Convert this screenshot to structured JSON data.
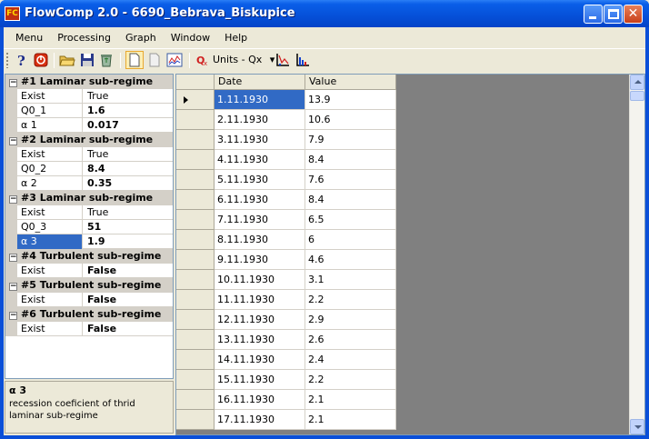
{
  "window": {
    "app_icon_text": "FC",
    "title": "FlowComp 2.0 - 6690_Bebrava_Biskupice",
    "close_glyph": "✕"
  },
  "menu": [
    "Menu",
    "Processing",
    "Graph",
    "Window",
    "Help"
  ],
  "toolbar": {
    "units_label": "Units - Qx",
    "units_dropdown_glyph": "▾",
    "icons": [
      "help-icon",
      "stop-icon",
      "open-folder-icon",
      "save-icon",
      "recycle-icon",
      "new-document-icon",
      "document-icon",
      "chart-icon",
      "qx-icon",
      "chart-axis-icon",
      "chart-bars-icon"
    ],
    "accent": "#316ac5"
  },
  "properties": {
    "groups": [
      {
        "title": "#1 Laminar sub-regime",
        "rows": [
          {
            "name": "Exist",
            "value": "True",
            "bold": false
          },
          {
            "name": "Q0_1",
            "value": "1.6",
            "bold": true
          },
          {
            "name": "α 1",
            "value": "0.017",
            "bold": true
          }
        ]
      },
      {
        "title": "#2 Laminar sub-regime",
        "rows": [
          {
            "name": "Exist",
            "value": "True",
            "bold": false
          },
          {
            "name": "Q0_2",
            "value": "8.4",
            "bold": true
          },
          {
            "name": "α 2",
            "value": "0.35",
            "bold": true
          }
        ]
      },
      {
        "title": "#3 Laminar sub-regime",
        "rows": [
          {
            "name": "Exist",
            "value": "True",
            "bold": false
          },
          {
            "name": "Q0_3",
            "value": "51",
            "bold": true
          },
          {
            "name": "α 3",
            "value": "1.9",
            "bold": true,
            "selected": true
          }
        ]
      },
      {
        "title": "#4 Turbulent sub-regime",
        "rows": [
          {
            "name": "Exist",
            "value": "False",
            "bold": true
          }
        ]
      },
      {
        "title": "#5 Turbulent sub-regime",
        "rows": [
          {
            "name": "Exist",
            "value": "False",
            "bold": true
          }
        ]
      },
      {
        "title": "#6 Turbulent sub-regime",
        "rows": [
          {
            "name": "Exist",
            "value": "False",
            "bold": true
          }
        ]
      }
    ],
    "description": {
      "title": "α 3",
      "text": "recession coeficient of thrid laminar sub-regime"
    }
  },
  "grid": {
    "columns": [
      "Date",
      "Value"
    ],
    "rows": [
      [
        "1.11.1930",
        "13.9"
      ],
      [
        "2.11.1930",
        "10.6"
      ],
      [
        "3.11.1930",
        "7.9"
      ],
      [
        "4.11.1930",
        "8.4"
      ],
      [
        "5.11.1930",
        "7.6"
      ],
      [
        "6.11.1930",
        "8.4"
      ],
      [
        "7.11.1930",
        "6.5"
      ],
      [
        "8.11.1930",
        "6"
      ],
      [
        "9.11.1930",
        "4.6"
      ],
      [
        "10.11.1930",
        "3.1"
      ],
      [
        "11.11.1930",
        "2.2"
      ],
      [
        "12.11.1930",
        "2.9"
      ],
      [
        "13.11.1930",
        "2.6"
      ],
      [
        "14.11.1930",
        "2.4"
      ],
      [
        "15.11.1930",
        "2.2"
      ],
      [
        "16.11.1930",
        "2.1"
      ],
      [
        "17.11.1930",
        "2.1"
      ]
    ],
    "selected_row": 0
  }
}
